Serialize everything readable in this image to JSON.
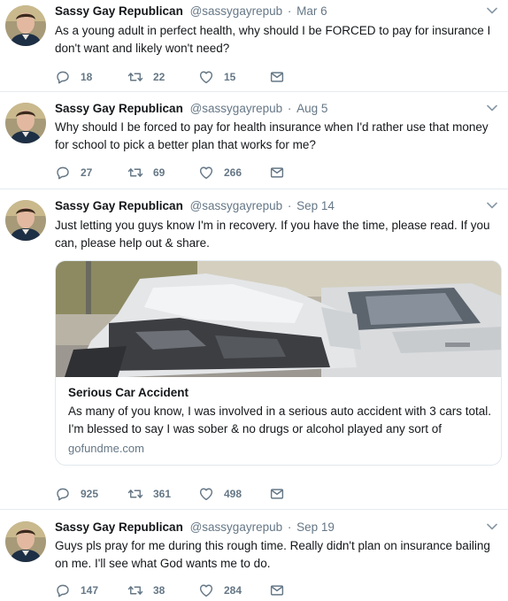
{
  "tweets": [
    {
      "name": "Sassy Gay Republican",
      "handle": "@sassygayrepub",
      "dot": "·",
      "date": "Mar 6",
      "text": "As a young adult in perfect health, why should I be FORCED to pay for insurance I don't want and likely won't need?",
      "replies": "18",
      "retweets": "22",
      "likes": "15"
    },
    {
      "name": "Sassy Gay Republican",
      "handle": "@sassygayrepub",
      "dot": "·",
      "date": "Aug 5",
      "text": "Why should I be forced to pay for health insurance when I'd rather use that money for school to pick a better plan that works for me?",
      "replies": "27",
      "retweets": "69",
      "likes": "266"
    },
    {
      "name": "Sassy Gay Republican",
      "handle": "@sassygayrepub",
      "dot": "·",
      "date": "Sep 14",
      "text": "Just letting you guys know I'm in recovery. If you have the time, please read. If you can, please help out & share.",
      "card": {
        "title": "Serious Car Accident",
        "description": "As many of you know, I was involved in a serious auto accident with 3 cars total. I'm blessed to say I was sober & no drugs or alcohol played any sort of",
        "domain": "gofundme.com"
      },
      "replies": "925",
      "retweets": "361",
      "likes": "498"
    },
    {
      "name": "Sassy Gay Republican",
      "handle": "@sassygayrepub",
      "dot": "·",
      "date": "Sep 19",
      "text": "Guys pls pray for me during this rough time. Really didn't plan on insurance bailing on me. I'll see what God wants me to do.",
      "replies": "147",
      "retweets": "38",
      "likes": "284"
    }
  ],
  "icons": {
    "reply": "reply-icon",
    "retweet": "retweet-icon",
    "like": "heart-icon",
    "message": "envelope-icon",
    "menu": "chevron-down-icon"
  },
  "colors": {
    "text": "#14171a",
    "secondary": "#657786",
    "divider": "#e6ecf0"
  }
}
